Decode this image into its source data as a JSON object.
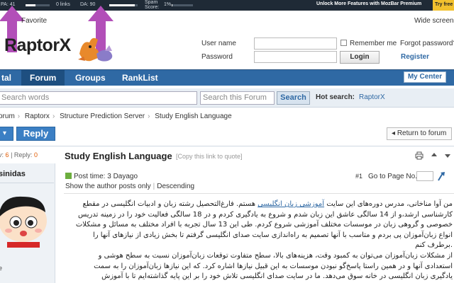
{
  "mozbar": {
    "pa": "PA: 41",
    "links": "0 links",
    "da": "DA: 90",
    "spam": "Spam\nScore:",
    "spam_value": "1%",
    "pa_fill": 0.41,
    "da_fill": 0.9,
    "promo": "Unlock More Features with MozBar Premium",
    "try": "Try free"
  },
  "header": {
    "favorite": "Favorite",
    "widescreen": "Wide screen",
    "logo": "RaptorX"
  },
  "login": {
    "username_label": "User name",
    "password_label": "Password",
    "remember_label": "Remember me",
    "forgot_label": "Forgot password?",
    "login_button": "Login",
    "register_label": "Register"
  },
  "nav": {
    "items": [
      "tal",
      "Forum",
      "Groups",
      "RankList"
    ],
    "my_center": "My Center"
  },
  "search": {
    "placeholder": "Search words",
    "scope": "Search this Forum",
    "button": "Search",
    "hot_label": "Hot search:",
    "hot_term": "RaptorX"
  },
  "breadcrumb": [
    "orum",
    "Raptorx",
    "Structure Prediction Server",
    "Study English Language"
  ],
  "actions": {
    "new_label": "▾",
    "reply": "Reply",
    "return": "Return to forum"
  },
  "thread": {
    "stats_prefix": "v:",
    "views": "6",
    "replies_label": "| Reply:",
    "replies": "0",
    "title": "Study English Language",
    "copy_link": "[Copy this link to quote]"
  },
  "author": {
    "name": "sinidas",
    "extra": "e"
  },
  "post": {
    "time": "Post time: 3 Dayago",
    "show_author": "Show the author posts only",
    "order": "Descending",
    "floor": "#1",
    "goto_label": "Go to Page No.",
    "body_lines": [
      "من آوا مناخانی، مدرس دوره‌های این سایت آموزشی زبان انگلیسی هستم. فارغ‌التحصیل رشته زبان و ادبیات انگلیسی در مقطع",
      "کارشناسی ارشد،و از 14 سالگی عاشق این زبان شدم و شروع به یادگیری کردم و در 18 سالگی فعالیت خود را در زمینه تدریس",
      "خصوصی و گروهی زبان در موسسات مختلف آموزشی شروع کردم. طی این 13 سال تجربه با افراد مختلف به مسائل و مشکلات",
      "انواع زبان‌آموزان پی بردم و متاسب با آنها تصمیم به راه‌اندازی سایت صدای انگلیسی گرفتم تا بخش زیادی از نیازهای آنها را",
      ".برطرف کنم",
      "از مشکلات زبان‌آموزان می‌توان به کمبود وقت، هزینه‌های بالا، سطح متفاوت توقعات زبان‌آموزان نسبت به سطح هوشی و",
      "استعدادی آنها و در همین راستا پاسخ‌گو نبودن موسسات به این قبیل نیازها اشاره کرد. که این نیازها زبان‌آموزان را به سمت",
      "یادگیری زبان انگلیسی در خانه سوق می‌دهد. ما در سایت صدای انگلیسی تلاش خود را بر این پایه گذاشته‌ایم تا با آموزش"
    ],
    "body_link": "آموزشی زبان انگلیسی"
  },
  "colors": {
    "nav": "#2f69a4",
    "arrow": "#b24fb8",
    "accent": "#e05a00"
  }
}
